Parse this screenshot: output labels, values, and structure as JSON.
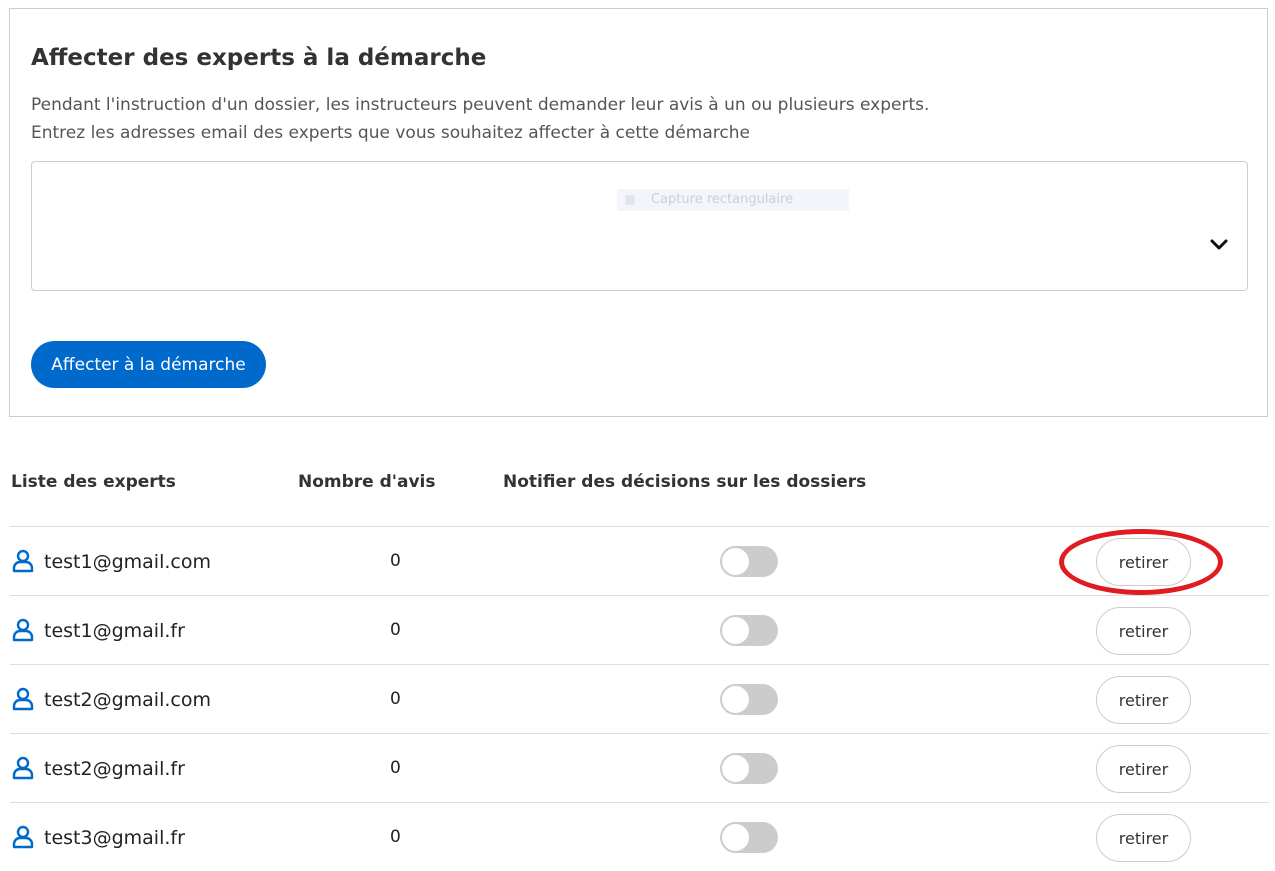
{
  "section": {
    "title": "Affecter des experts à la démarche",
    "description_line1": "Pendant l'instruction d'un dossier, les instructeurs peuvent demander leur avis à un ou plusieurs experts.",
    "description_line2": "Entrez les adresses email des experts que vous souhaitez affecter à cette démarche",
    "select_overlay_text": "Capture rectangulaire",
    "submit_label": "Affecter à la démarche"
  },
  "table": {
    "headers": {
      "experts": "Liste des experts",
      "count": "Nombre d'avis",
      "notify": "Notifier des décisions sur les dossiers"
    },
    "rows": [
      {
        "email": "test1@gmail.com",
        "count": "0",
        "notify": false,
        "action": "retirer"
      },
      {
        "email": "test1@gmail.fr",
        "count": "0",
        "notify": false,
        "action": "retirer"
      },
      {
        "email": "test2@gmail.com",
        "count": "0",
        "notify": false,
        "action": "retirer"
      },
      {
        "email": "test2@gmail.fr",
        "count": "0",
        "notify": false,
        "action": "retirer"
      },
      {
        "email": "test3@gmail.fr",
        "count": "0",
        "notify": false,
        "action": "retirer"
      }
    ]
  },
  "icons": {
    "user": "user-icon",
    "chevron": "chevron-down-icon"
  },
  "colors": {
    "primary": "#0069cc",
    "highlight": "#e01b22",
    "toggle_off": "#cccccc"
  }
}
